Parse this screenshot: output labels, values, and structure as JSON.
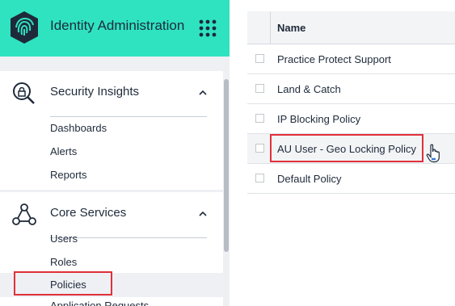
{
  "header": {
    "app_title": "Identity Administration",
    "brand_color": "#2fe3c1",
    "logo_icon": "fingerprint-shield-icon",
    "apps_icon": "grid-dots-icon"
  },
  "sidebar": {
    "groups": [
      {
        "title": "Security Insights",
        "icon": "search-lock-icon",
        "expanded": true,
        "items": [
          {
            "label": "Dashboards"
          },
          {
            "label": "Alerts"
          },
          {
            "label": "Reports"
          }
        ]
      },
      {
        "title": "Core Services",
        "icon": "network-nodes-icon",
        "expanded": true,
        "items": [
          {
            "label": "Users"
          },
          {
            "label": "Roles"
          },
          {
            "label": "Policies",
            "active": true
          },
          {
            "label": "Application Requests"
          }
        ]
      }
    ]
  },
  "table": {
    "column_header": "Name",
    "rows": [
      {
        "name": "Practice Protect Support"
      },
      {
        "name": "Land & Catch"
      },
      {
        "name": "IP Blocking Policy"
      },
      {
        "name": "AU User - Geo Locking Policy",
        "hovered": true
      },
      {
        "name": "Default Policy"
      }
    ]
  },
  "colors": {
    "highlight": "#e0303a",
    "sidebar_bg": "#eef0f4"
  }
}
